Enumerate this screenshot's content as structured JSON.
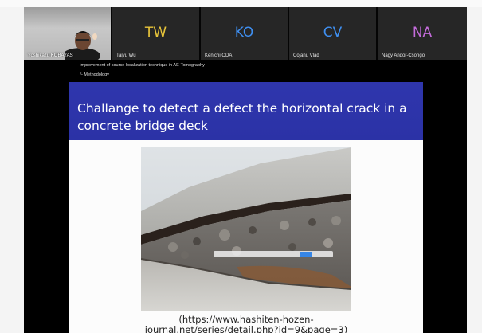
{
  "participants": [
    {
      "name": "Yoshikazu KOBAYAS",
      "initials": "",
      "video": true
    },
    {
      "name": "Taiyu Wu",
      "initials": "TW",
      "color": "#e7c43a"
    },
    {
      "name": "Kenichi ODA",
      "initials": "KO",
      "color": "#3f8ff0"
    },
    {
      "name": "Cojanu Vlad",
      "initials": "CV",
      "color": "#3f8ff0"
    },
    {
      "name": "Nagy Andor-Csongo",
      "initials": "NA",
      "color": "#c46cdb"
    }
  ],
  "slide": {
    "breadcrumb": "Improvement of source localization technique in AE-Tomography",
    "section": "└ Methodology",
    "title": "Challange to detect a defect the horizontal crack in a concrete bridge deck",
    "caption_line1": "(https://www.hashiten-hozen-",
    "caption_line2": "journal.net/series/detail.php?id=9&page=3)"
  },
  "colors": {
    "slide_header": "#2f36ad",
    "window_bg": "#000000",
    "tile_bg": "#262626"
  }
}
